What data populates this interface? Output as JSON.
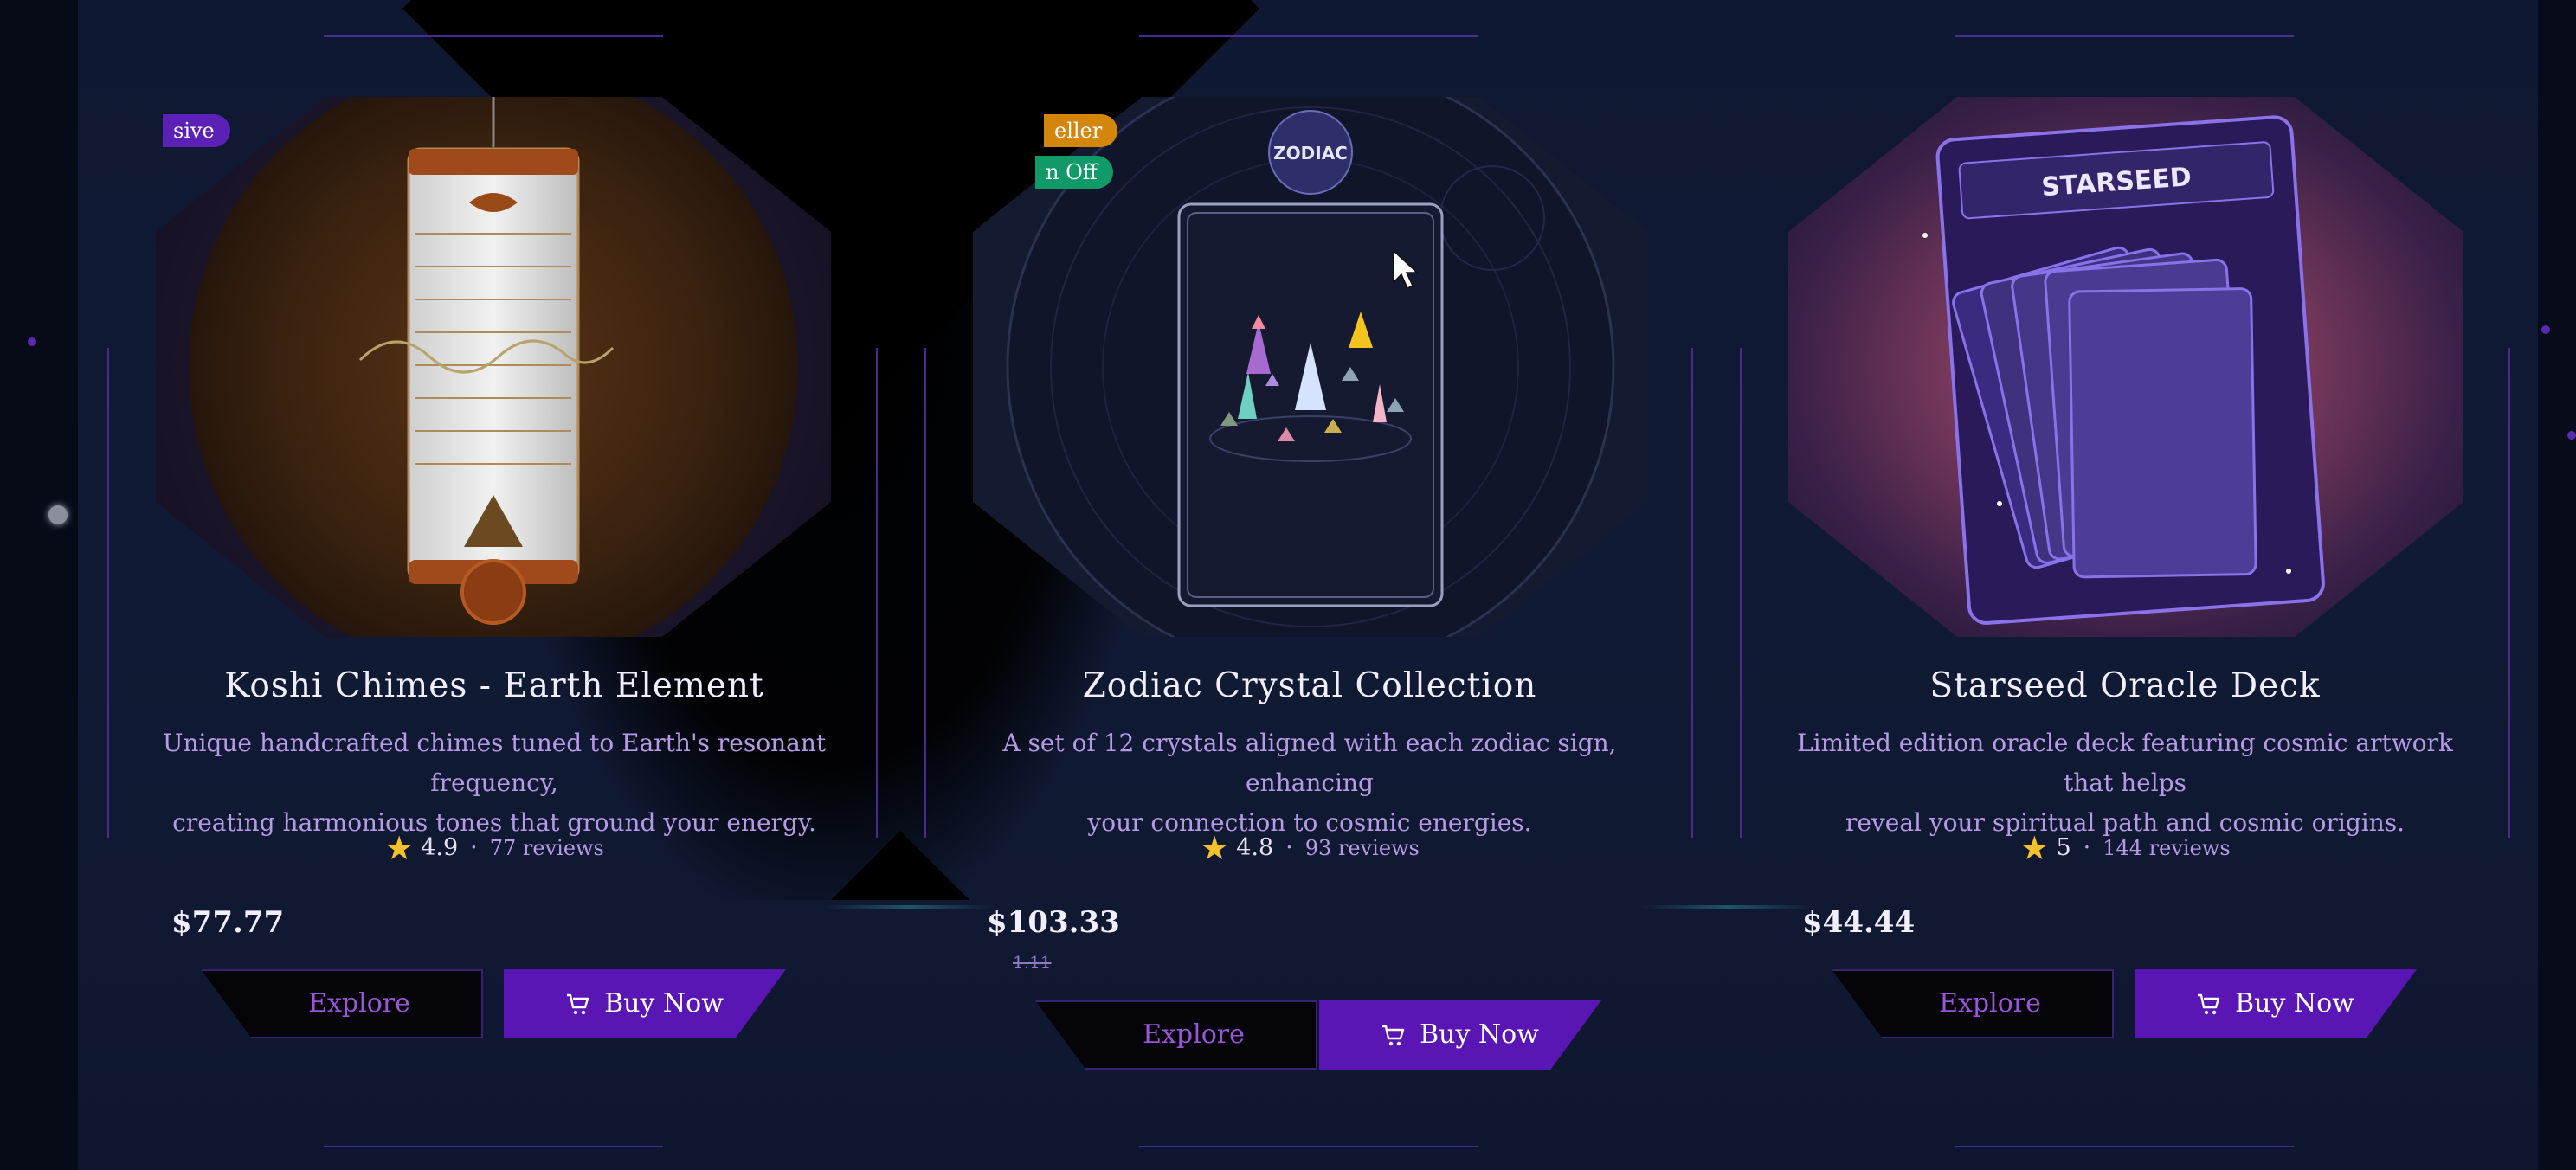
{
  "products": [
    {
      "badge": "sive",
      "badge_color": "#5b21b6",
      "title": "Koshi Chimes - Earth Element",
      "description_line1": "Unique handcrafted chimes tuned to Earth's resonant frequency,",
      "description_line2": "creating harmonious tones that ground your energy.",
      "rating": "4.9",
      "reviews": "77 reviews",
      "price": "$77.77",
      "explore": "Explore",
      "buy": "Buy Now"
    },
    {
      "badge1": "eller",
      "badge1_color": "#d4860b",
      "badge2": "n Off",
      "badge2_color": "#0f9a68",
      "zodiac_label": "ZODIAC",
      "title": "Zodiac Crystal Collection",
      "description_line1": "A set of 12 crystals aligned with each zodiac sign, enhancing",
      "description_line2": "your connection to cosmic energies.",
      "rating": "4.8",
      "reviews": "93 reviews",
      "price": "$103.33",
      "old_price": "1.11",
      "explore": "Explore",
      "buy": "Buy Now"
    },
    {
      "card_label": "STARSEED",
      "title": "Starseed Oracle Deck",
      "description_line1": "Limited edition oracle deck featuring cosmic artwork that helps",
      "description_line2": "reveal your spiritual path and cosmic origins.",
      "rating": "5",
      "reviews": "144 reviews",
      "price": "$44.44",
      "explore": "Explore",
      "buy": "Buy Now"
    }
  ],
  "colors": {
    "accent_purple": "#5a16b4",
    "star": "#f5c02b",
    "text_muted": "#b79ae6",
    "background": "#111a34"
  }
}
